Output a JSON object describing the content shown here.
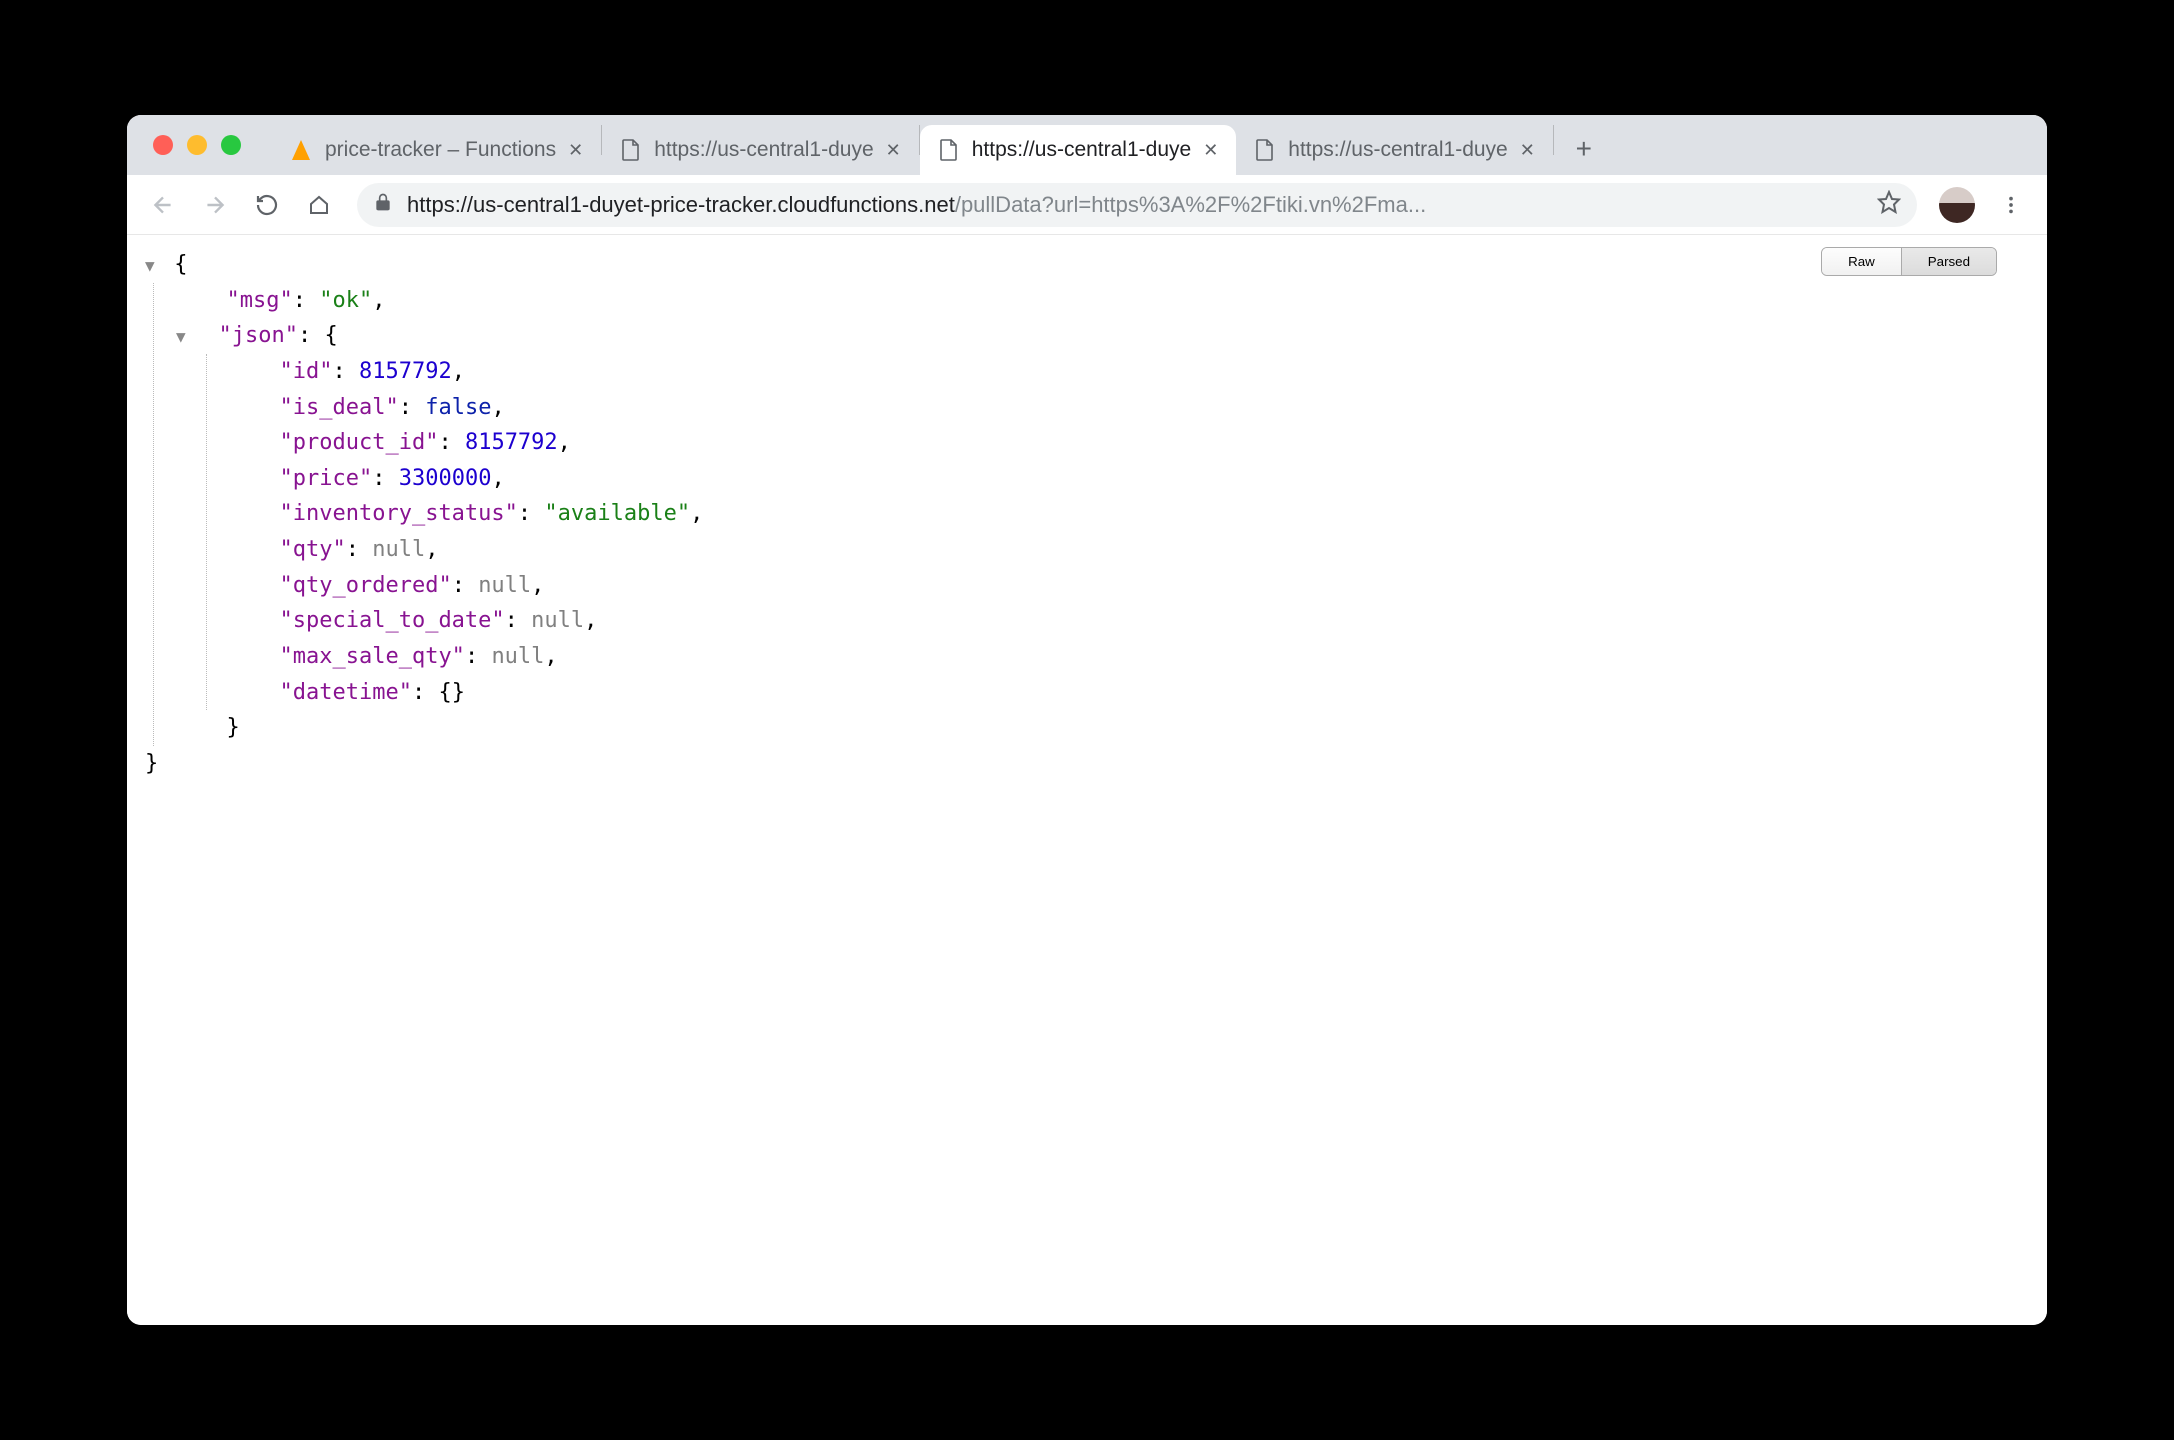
{
  "tabs": [
    {
      "title": "price-tracker – Functions",
      "icon": "firebase",
      "active": false
    },
    {
      "title": "https://us-central1-duye",
      "icon": "page",
      "active": false
    },
    {
      "title": "https://us-central1-duye",
      "icon": "page",
      "active": true
    },
    {
      "title": "https://us-central1-duye",
      "icon": "page",
      "active": false
    }
  ],
  "url": {
    "host": "https://us-central1-duyet-price-tracker.cloudfunctions.net",
    "path": "/pullData?url=https%3A%2F%2Ftiki.vn%2Fma..."
  },
  "view_toggle": {
    "raw": "Raw",
    "parsed": "Parsed"
  },
  "json_body": {
    "msg_key": "\"msg\"",
    "msg_val": "\"ok\"",
    "json_key": "\"json\"",
    "id_key": "\"id\"",
    "id_val": "8157792",
    "is_deal_key": "\"is_deal\"",
    "is_deal_val": "false",
    "product_id_key": "\"product_id\"",
    "product_id_val": "8157792",
    "price_key": "\"price\"",
    "price_val": "3300000",
    "inventory_status_key": "\"inventory_status\"",
    "inventory_status_val": "\"available\"",
    "qty_key": "\"qty\"",
    "qty_val": "null",
    "qty_ordered_key": "\"qty_ordered\"",
    "qty_ordered_val": "null",
    "special_to_date_key": "\"special_to_date\"",
    "special_to_date_val": "null",
    "max_sale_qty_key": "\"max_sale_qty\"",
    "max_sale_qty_val": "null",
    "datetime_key": "\"datetime\"",
    "datetime_val": "{}"
  }
}
